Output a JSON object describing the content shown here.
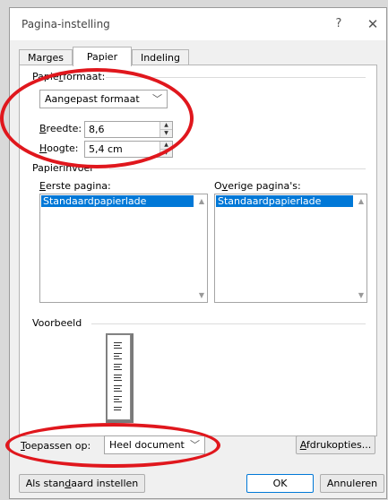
{
  "window": {
    "title": "Pagina-instelling",
    "help_label": "?",
    "close_label": "✕"
  },
  "tabs": [
    {
      "label": "Marges",
      "active": false
    },
    {
      "label": "Papier",
      "active": true
    },
    {
      "label": "Indeling",
      "active": false
    }
  ],
  "papierformaat": {
    "group_label": "Papierformaat:",
    "group_label_pre": "Papie",
    "group_label_key": "r",
    "group_label_post": "formaat:",
    "selected": "Aangepast formaat",
    "breedte": {
      "key": "B",
      "rest": "reedte:",
      "value": "8,6"
    },
    "hoogte": {
      "key": "H",
      "rest": "oogte:",
      "value": "5,4 cm"
    }
  },
  "papierinvoer": {
    "group_label": "Papierinvoer",
    "eerste": {
      "key": "E",
      "rest": "erste pagina:",
      "item": "Standaardpapierlade"
    },
    "overige": {
      "pre": "O",
      "key": "v",
      "rest": "erige pagina's:",
      "item": "Standaardpapierlade"
    }
  },
  "voorbeeld": {
    "group_label": "Voorbeeld"
  },
  "toepassen": {
    "key": "T",
    "rest": "oepassen op:",
    "selected": "Heel document"
  },
  "buttons": {
    "afdrukopties": {
      "key": "A",
      "rest": "fdrukopties..."
    },
    "standaard": {
      "pre": "Als stan",
      "key": "d",
      "rest": "aard instellen"
    },
    "ok": "OK",
    "annuleren": "Annuleren"
  },
  "colors": {
    "highlight": "#0078d7",
    "annotation": "#e0171d"
  }
}
